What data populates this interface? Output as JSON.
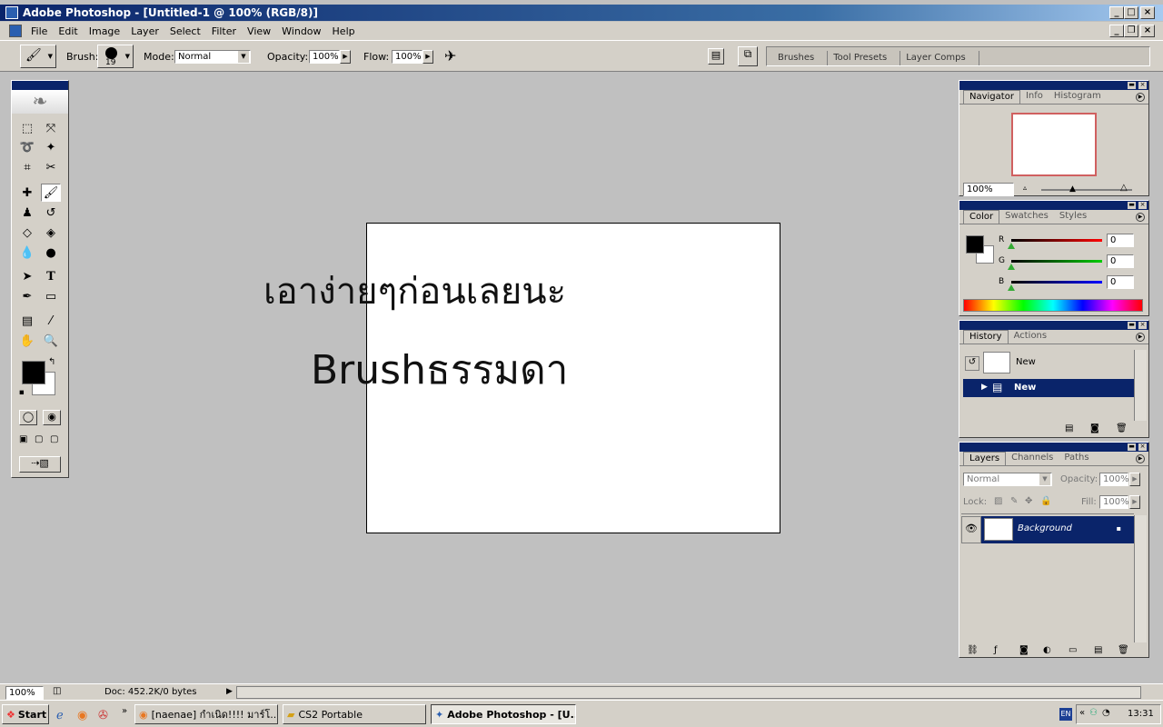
{
  "window": {
    "title": "Adobe Photoshop - [Untitled-1 @ 100% (RGB/8)]"
  },
  "menu": [
    "File",
    "Edit",
    "Image",
    "Layer",
    "Select",
    "Filter",
    "View",
    "Window",
    "Help"
  ],
  "options": {
    "brush_label": "Brush:",
    "brush_size": "19",
    "mode_label": "Mode:",
    "mode_value": "Normal",
    "opacity_label": "Opacity:",
    "opacity_value": "100%",
    "flow_label": "Flow:",
    "flow_value": "100%"
  },
  "palette_well": [
    "Brushes",
    "Tool Presets",
    "Layer Comps"
  ],
  "canvas_text": {
    "line1": "เอาง่ายๆก่อนเลยนะ",
    "line2": "Brushธรรมดา"
  },
  "navigator": {
    "tabs": [
      "Navigator",
      "Info",
      "Histogram"
    ],
    "zoom": "100%"
  },
  "color_panel": {
    "tabs": [
      "Color",
      "Swatches",
      "Styles"
    ],
    "r_label": "R",
    "r_value": "0",
    "g_label": "G",
    "g_value": "0",
    "b_label": "B",
    "b_value": "0",
    "fg_color": "#000000",
    "bg_color": "#ffffff"
  },
  "history": {
    "tabs": [
      "History",
      "Actions"
    ],
    "snapshot_label": "New",
    "step_label": "New"
  },
  "layers": {
    "tabs": [
      "Layers",
      "Channels",
      "Paths"
    ],
    "blend_mode": "Normal",
    "opacity_label": "Opacity:",
    "opacity_value": "100%",
    "lock_label": "Lock:",
    "fill_label": "Fill:",
    "fill_value": "100%",
    "layer_name": "Background"
  },
  "statusbar": {
    "zoom": "100%",
    "doc_info": "Doc: 452.2K/0 bytes"
  },
  "taskbar": {
    "start": "Start",
    "tasks": [
      "[naenae] กำเนิด!!!! มาร์โ...",
      "CS2 Portable",
      "Adobe Photoshop - [U..."
    ],
    "lang": "EN",
    "time": "13:31"
  }
}
